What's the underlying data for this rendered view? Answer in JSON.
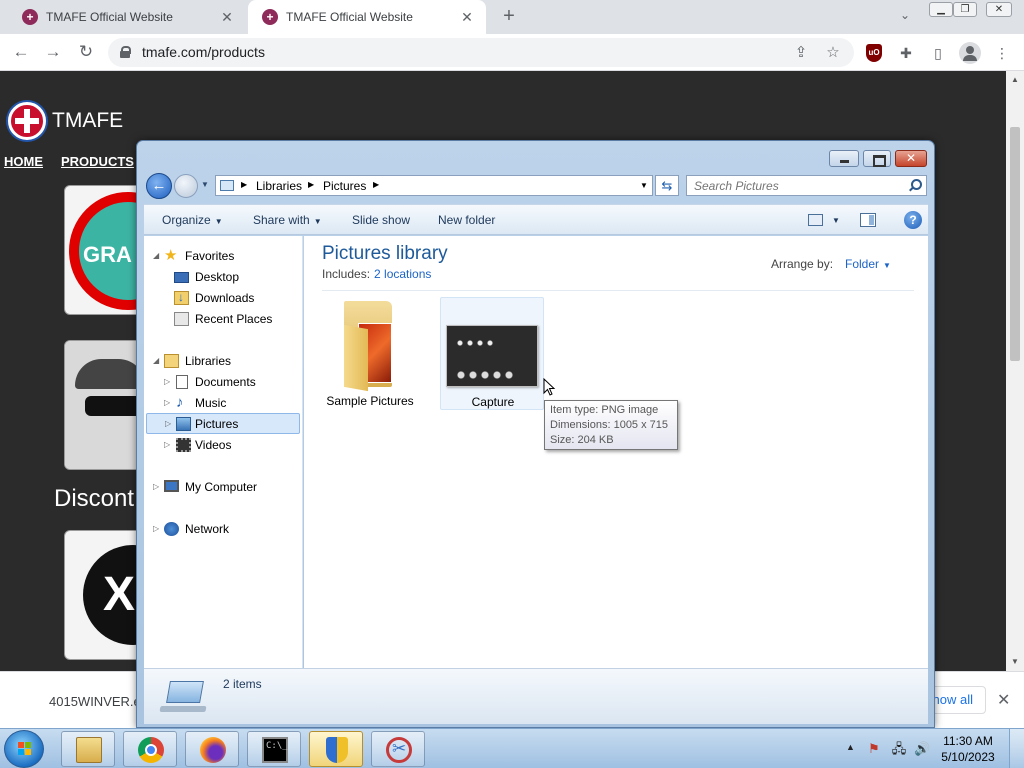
{
  "browser": {
    "tabs": [
      {
        "title": "TMAFE Official Website"
      },
      {
        "title": "TMAFE Official Website"
      }
    ],
    "url": "tmafe.com/products"
  },
  "website": {
    "name": "TMAFE",
    "nav": [
      "HOME",
      "PRODUCTS"
    ],
    "card1_text": "GRA",
    "card3_text": "X",
    "discontinued_text": "Discont"
  },
  "download_bar": {
    "filename": "4015WINVER.e",
    "show_all": "how all"
  },
  "explorer": {
    "breadcrumb": [
      "Libraries",
      "Pictures"
    ],
    "search_placeholder": "Search Pictures",
    "commands": {
      "organize": "Organize",
      "share_with": "Share with",
      "slide_show": "Slide show",
      "new_folder": "New folder"
    },
    "nav": {
      "favorites": "Favorites",
      "desktop": "Desktop",
      "downloads": "Downloads",
      "recent_places": "Recent Places",
      "libraries": "Libraries",
      "documents": "Documents",
      "music": "Music",
      "pictures": "Pictures",
      "videos": "Videos",
      "my_computer": "My Computer",
      "network": "Network"
    },
    "library": {
      "title": "Pictures library",
      "includes_label": "Includes:",
      "includes_link": "2 locations",
      "arrange_label": "Arrange by:",
      "arrange_value": "Folder"
    },
    "items": [
      {
        "name": "Sample Pictures"
      },
      {
        "name": "Capture"
      }
    ],
    "tooltip": {
      "type": "Item type: PNG image",
      "dimensions": "Dimensions: 1005 x 715",
      "size": "Size: 204 KB"
    },
    "status": "2 items"
  },
  "taskbar": {
    "cmd_prompt": "C:\\_",
    "time": "11:30 AM",
    "date": "5/10/2023"
  }
}
